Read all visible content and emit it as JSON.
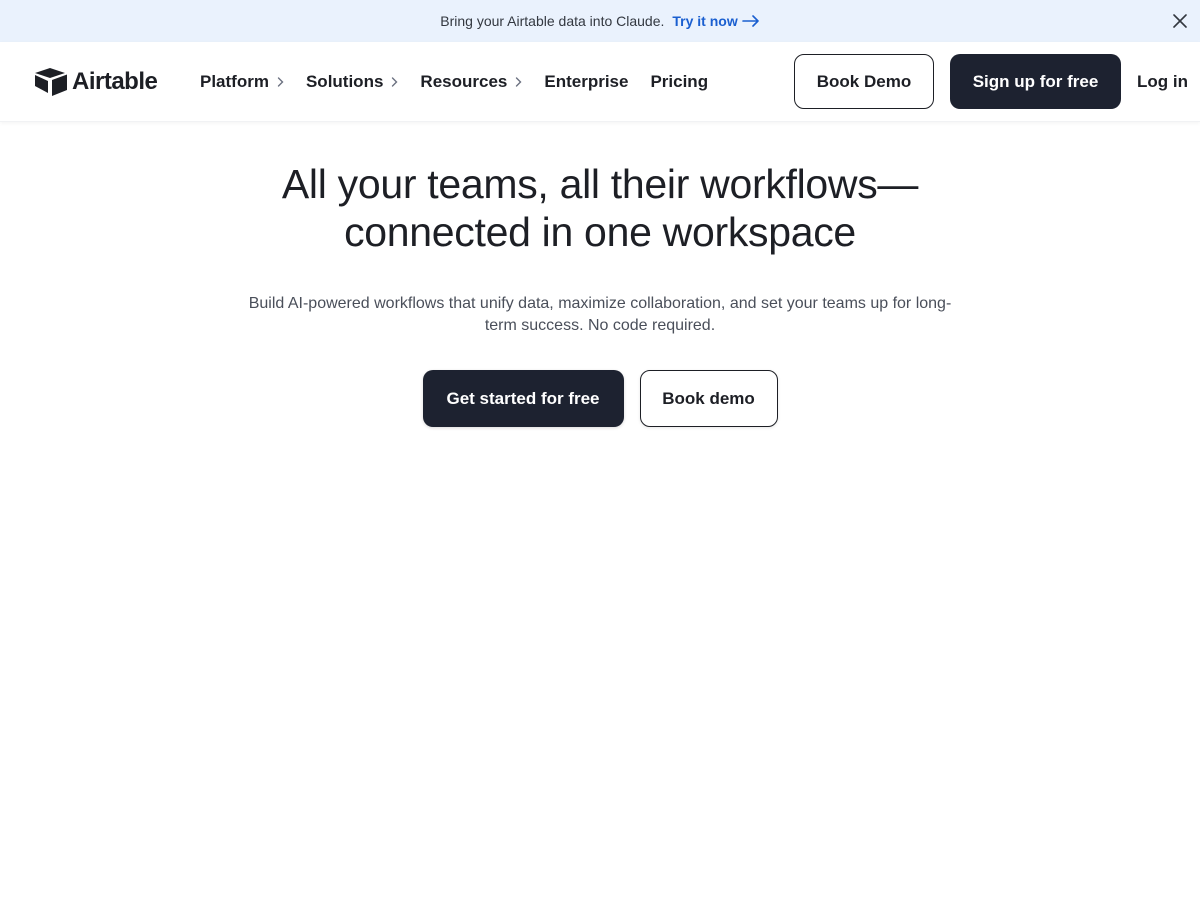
{
  "banner": {
    "text": "Bring your Airtable data into Claude.",
    "link_label": "Try it now",
    "link_icon": "arrow-right-icon",
    "close_icon": "close-icon"
  },
  "nav": {
    "logo_text": "Airtable",
    "logo_icon": "airtable-box-logo",
    "items": [
      {
        "label": "Platform",
        "has_chevron": true
      },
      {
        "label": "Solutions",
        "has_chevron": true
      },
      {
        "label": "Resources",
        "has_chevron": true
      },
      {
        "label": "Enterprise",
        "has_chevron": false
      },
      {
        "label": "Pricing",
        "has_chevron": false
      }
    ],
    "book_demo_label": "Book Demo",
    "signup_label": "Sign up for free",
    "login_label": "Log in"
  },
  "hero": {
    "title_line1": "All your teams, all their workflows—",
    "title_line2": "connected in one workspace",
    "subtitle_line1": "Build AI-powered workflows that unify data, maximize collaboration, and set your teams up for long-",
    "subtitle_line2": "term success. No code required.",
    "primary_cta": "Get started for free",
    "secondary_cta": "Book demo"
  },
  "colors": {
    "banner_bg": "#eaf2fd",
    "link": "#1a5fd0",
    "dark_button": "#1d2230",
    "text": "#1d1f25"
  }
}
